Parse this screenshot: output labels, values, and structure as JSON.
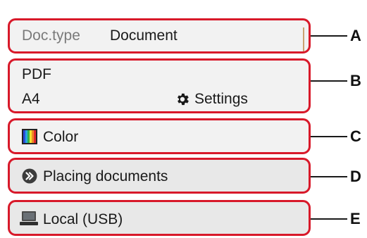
{
  "rows": {
    "doc_type": {
      "label": "Doc.type",
      "value": "Document",
      "callout": "A"
    },
    "format": {
      "file_type": "PDF",
      "size": "A4",
      "settings_label": "Settings",
      "settings_icon": "gear-icon",
      "callout": "B"
    },
    "color": {
      "label": "Color",
      "icon": "color-palette-icon",
      "callout": "C"
    },
    "placing": {
      "label": "Placing documents",
      "icon": "double-chevron-right-icon",
      "callout": "D"
    },
    "save_to": {
      "label": "Local (USB)",
      "icon": "computer-icon",
      "callout": "E"
    }
  },
  "colors": {
    "outline": "#d8192a",
    "panel": "#f2f2f2",
    "panel_gray": "#e8e8e8",
    "text": "#1a1a1a",
    "muted": "#7a7a7a"
  }
}
